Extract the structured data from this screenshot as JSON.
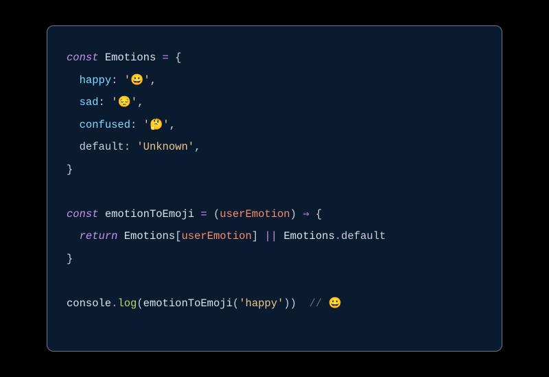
{
  "code": {
    "l1_const": "const",
    "l1_var": "Emotions",
    "l1_eq": " = ",
    "l1_brace": "{",
    "l2_indent": "  ",
    "l2_key": "happy",
    "l2_colon": ": ",
    "l2_q1": "'",
    "l2_val": "😀",
    "l2_q2": "'",
    "l2_comma": ",",
    "l3_indent": "  ",
    "l3_key": "sad",
    "l3_colon": ": ",
    "l3_q1": "'",
    "l3_val": "😔",
    "l3_q2": "'",
    "l3_comma": ",",
    "l4_indent": "  ",
    "l4_key": "confused",
    "l4_colon": ": ",
    "l4_q1": "'",
    "l4_val": "🤔",
    "l4_q2": "'",
    "l4_comma": ",",
    "l5_indent": "  ",
    "l5_key": "default",
    "l5_colon": ": ",
    "l5_q1": "'",
    "l5_val": "Unknown",
    "l5_q2": "'",
    "l5_comma": ",",
    "l6_brace": "}",
    "l8_const": "const",
    "l8_var": "emotionToEmoji",
    "l8_eq": " = ",
    "l8_lp": "(",
    "l8_param": "userEmotion",
    "l8_rp": ")",
    "l8_arrow": " ⇒ ",
    "l8_brace": "{",
    "l9_indent": "  ",
    "l9_return": "return",
    "l9_sp": " ",
    "l9_obj": "Emotions",
    "l9_lb": "[",
    "l9_param": "userEmotion",
    "l9_rb": "]",
    "l9_or": " || ",
    "l9_obj2": "Emotions",
    "l9_dot": ".",
    "l9_default": "default",
    "l10_brace": "}",
    "l12_console": "console",
    "l12_dot": ".",
    "l12_log": "log",
    "l12_lp": "(",
    "l12_fn": "emotionToEmoji",
    "l12_lp2": "(",
    "l12_q1": "'",
    "l12_arg": "happy",
    "l12_q2": "'",
    "l12_rp2": ")",
    "l12_rp": ")",
    "l12_sp": "  ",
    "l12_comment": "// 😀"
  }
}
